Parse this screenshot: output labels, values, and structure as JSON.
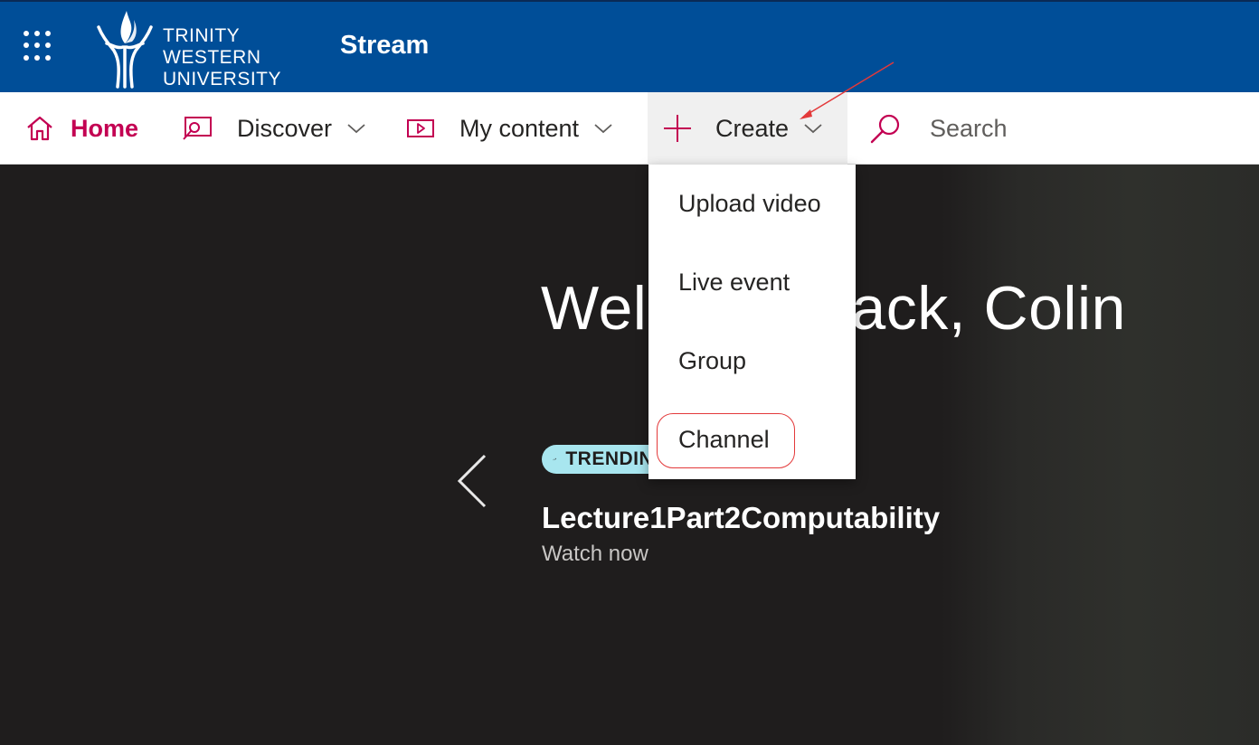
{
  "suite": {
    "org_lines": [
      "TRINITY",
      "WESTERN",
      "UNIVERSITY"
    ],
    "app_title": "Stream"
  },
  "nav": {
    "home": "Home",
    "discover": "Discover",
    "my_content": "My content",
    "create": "Create",
    "search_placeholder": "Search"
  },
  "create_menu": {
    "items": [
      "Upload video",
      "Live event",
      "Group",
      "Channel"
    ]
  },
  "hero": {
    "welcome": "Welcome back, Colin",
    "badge": "TRENDING",
    "video_title": "Lecture1Part2Computability",
    "watch_now": "Watch now"
  },
  "colors": {
    "suite_bar": "#004e98",
    "accent": "#c30052",
    "badge_bg": "#a8e6ef",
    "annotation": "#e3393a"
  },
  "icons": {
    "waffle": "app-launcher-icon",
    "home": "home-icon",
    "discover": "discover-icon",
    "my_content": "video-icon",
    "create": "plus-icon",
    "search": "search-icon",
    "trending": "trending-icon",
    "prev": "chevron-left-icon"
  }
}
